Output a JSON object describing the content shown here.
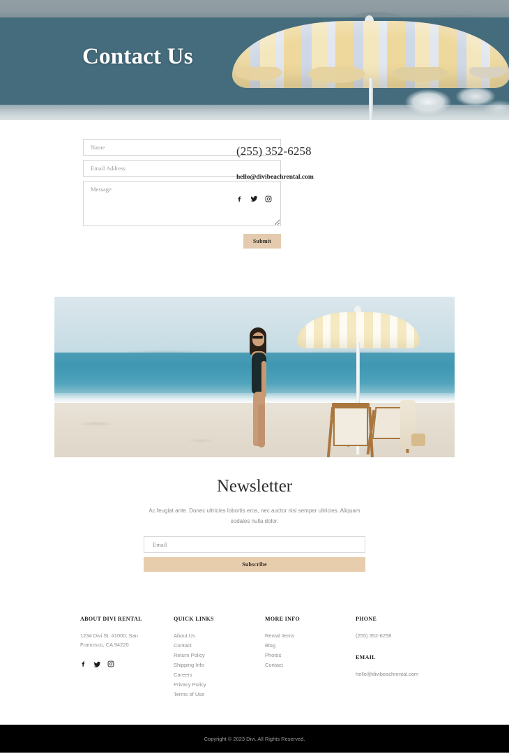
{
  "hero": {
    "title": "Contact Us",
    "background": "beach-umbrella-ocean-photo"
  },
  "contact": {
    "form": {
      "name_placeholder": "Name",
      "email_placeholder": "Email Address",
      "message_placeholder": "Message",
      "submit_label": "Submit"
    },
    "phone": "(255) 352-6258",
    "email": "hello@divibeachrental.com",
    "social": [
      {
        "name": "facebook",
        "glyph": "f"
      },
      {
        "name": "twitter",
        "glyph": "t"
      },
      {
        "name": "instagram",
        "glyph": "i"
      }
    ]
  },
  "feature_image": {
    "alt": "woman-on-beach-with-umbrella-and-deck-chairs"
  },
  "newsletter": {
    "title": "Newsletter",
    "description": "Ac feugiat ante. Donec ultricies lobortis eros, nec auctor nisl semper ultricies. Aliquam sodales nulla dolor.",
    "email_placeholder": "Email",
    "subscribe_label": "Subscribe"
  },
  "footer": {
    "about": {
      "heading": "ABOUT DIVI RENTAL",
      "address_line1": "1234 Divi St. #1000, San",
      "address_line2": "Francisco, CA 94220",
      "social": [
        {
          "name": "facebook",
          "glyph": "f"
        },
        {
          "name": "twitter",
          "glyph": "t"
        },
        {
          "name": "instagram",
          "glyph": "i"
        }
      ]
    },
    "quick_links": {
      "heading": "QUICK LINKS",
      "items": [
        "About Us",
        "Contact",
        "Return Policy",
        "Shipping Info",
        "Careers",
        "Privacy Policy",
        "Terms of Use"
      ]
    },
    "more_info": {
      "heading": "MORE INFO",
      "items": [
        "Rental Items",
        "Blog",
        "Photos",
        "Contact"
      ]
    },
    "contact": {
      "phone_heading": "PHONE",
      "phone": "(255) 352-6258",
      "email_heading": "EMAIL",
      "email": "hello@divibeachrental.com"
    },
    "copyright": "Copyright © 2023 Divi. All Rights Reserved."
  },
  "colors": {
    "accent_button": "#e4caae",
    "accent_subscribe": "#e8cdad",
    "hero_ocean": "#456c7c",
    "copybar_bg": "#000000",
    "muted_text": "#8e8e8e"
  }
}
